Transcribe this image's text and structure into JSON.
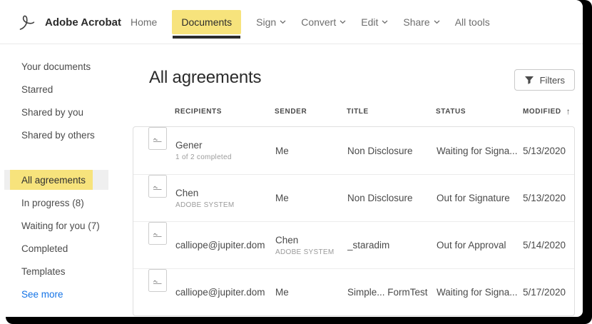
{
  "header": {
    "brand": "Adobe Acrobat",
    "nav": [
      {
        "label": "Home"
      },
      {
        "label": "Documents"
      },
      {
        "label": "Sign"
      },
      {
        "label": "Convert"
      },
      {
        "label": "Edit"
      },
      {
        "label": "Share"
      },
      {
        "label": "All tools"
      }
    ]
  },
  "sidebar": {
    "top_items": [
      {
        "label": "Your documents"
      },
      {
        "label": "Starred"
      },
      {
        "label": "Shared by you"
      },
      {
        "label": "Shared by others"
      }
    ],
    "bottom_items": [
      {
        "label": "All agreements"
      },
      {
        "label": "In progress (8)"
      },
      {
        "label": "Waiting for you (7)"
      },
      {
        "label": "Completed"
      },
      {
        "label": "Templates"
      }
    ],
    "see_more": "See more"
  },
  "main": {
    "title": "All agreements",
    "filters_label": "Filters",
    "table": {
      "columns": [
        "RECIPIENTS",
        "SENDER",
        "TITLE",
        "STATUS",
        "MODIFIED"
      ],
      "sort_icon": "↑",
      "rows": [
        {
          "recipient": "Gener",
          "recipient_sub": "1 of 2 completed",
          "sender": "Me",
          "sender_sub": "",
          "title": "Non Disclosure",
          "status": "Waiting for Signa...",
          "modified": "5/13/2020"
        },
        {
          "recipient": "Chen",
          "recipient_sub": "ADOBE SYSTEM",
          "sender": "Me",
          "sender_sub": "",
          "title": "Non Disclosure",
          "status": "Out for Signature",
          "modified": "5/13/2020"
        },
        {
          "recipient": "calliope@jupiter.dom",
          "recipient_sub": "",
          "sender": "Chen",
          "sender_sub": "ADOBE SYSTEM",
          "title": "_staradim",
          "status": "Out for Approval",
          "modified": "5/14/2020"
        },
        {
          "recipient": "calliope@jupiter.dom",
          "recipient_sub": "",
          "sender": "Me",
          "sender_sub": "",
          "title": "Simple... FormTest",
          "status": "Waiting for Signa...",
          "modified": "5/17/2020"
        }
      ]
    }
  },
  "icons": {
    "logo": "acrobat-quill-icon",
    "nav_dropdown": "chevron-down-icon",
    "filters": "funnel-icon",
    "sort": "arrow-up-icon",
    "row_document": "agreement-document-icon"
  },
  "colors": {
    "highlight_yellow": "#F7E37C",
    "link_blue": "#1473E6",
    "accent_dark": "#2C2C2C"
  }
}
